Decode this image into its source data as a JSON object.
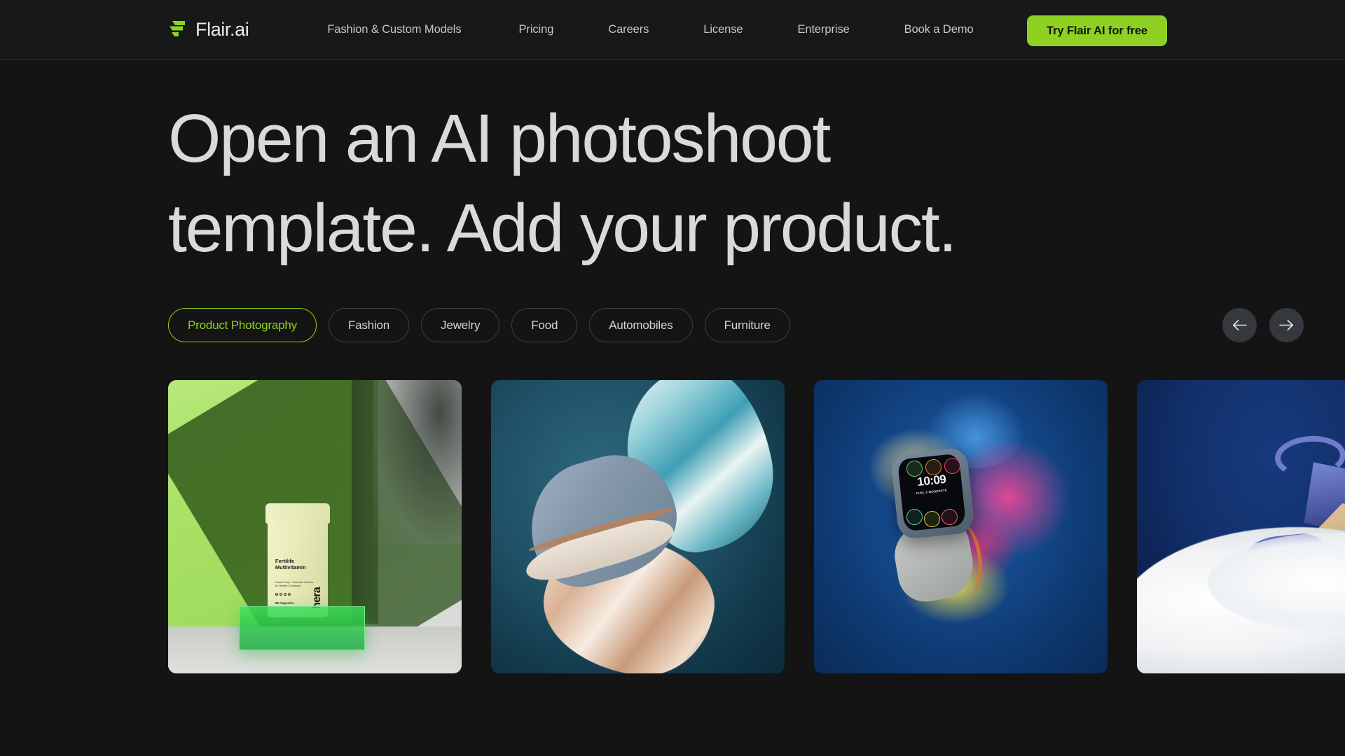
{
  "brand": {
    "name": "Flair.ai",
    "logo_icon": "flair-logo-icon",
    "accent_color": "#8ed122"
  },
  "header": {
    "nav_items": [
      {
        "label": "Fashion & Custom Models"
      },
      {
        "label": "Pricing"
      },
      {
        "label": "Careers"
      },
      {
        "label": "License"
      },
      {
        "label": "Enterprise"
      },
      {
        "label": "Book a Demo"
      }
    ],
    "cta_label": "Try Flair AI  for free"
  },
  "hero": {
    "headline": "Open an AI photoshoot\ntemplate. Add your product."
  },
  "filters": {
    "pills": [
      {
        "label": "Product Photography",
        "active": true
      },
      {
        "label": "Fashion",
        "active": false
      },
      {
        "label": "Jewelry",
        "active": false
      },
      {
        "label": "Food",
        "active": false
      },
      {
        "label": "Automobiles",
        "active": false
      },
      {
        "label": "Furniture",
        "active": false
      }
    ],
    "prev_icon": "arrow-left-icon",
    "next_icon": "arrow-right-icon"
  },
  "gallery": {
    "cards": [
      {
        "id": "card-vitamin-bottle",
        "description": "Supplement bottle on green acrylic block against green wall",
        "product_brand": "hera",
        "product_title": "Fertilife\nMultivitamin",
        "product_subtitle": "Chaste Berry +\nEssential Vitamins for\nHealthy Conception",
        "product_count": "90 Capsules"
      },
      {
        "id": "card-suede-shoe",
        "description": "Grey suede brogue shoe with flowing teal and champagne silk on teal background"
      },
      {
        "id": "card-smart-watch",
        "description": "Smartwatch with alpine loop band amid colored smoke clouds on blue background",
        "watch_time": "10:09",
        "watch_condition": "FUEL 5 MODERATE"
      },
      {
        "id": "card-wedge-sandal",
        "description": "Blue suede espadrille wedge sandal on white fur against navy background"
      }
    ]
  }
}
